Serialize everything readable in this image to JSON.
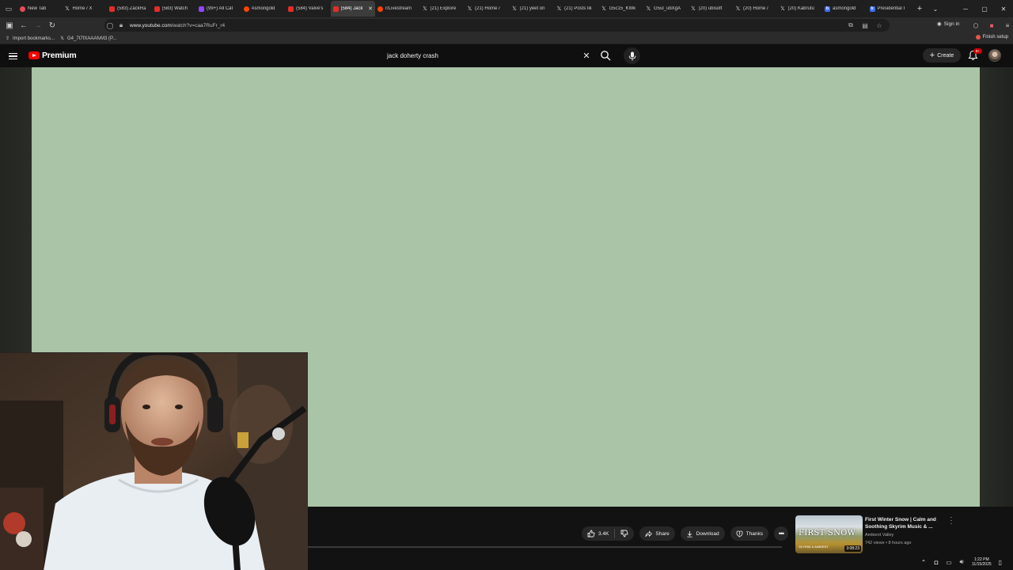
{
  "browser": {
    "tabs": [
      {
        "label": "New Tab",
        "icon": "browser-icon",
        "fav": "am"
      },
      {
        "label": "Home / X",
        "icon": "x-icon",
        "fav": "x"
      },
      {
        "label": "(583) ZackRa",
        "icon": "youtube-icon",
        "fav": "yt"
      },
      {
        "label": "(583) Watch",
        "icon": "youtube-icon",
        "fav": "yt"
      },
      {
        "label": "(99+) All Cat",
        "icon": "twitch-icon",
        "fav": "tw"
      },
      {
        "label": "Asmongold",
        "icon": "reddit-icon",
        "fav": "rd"
      },
      {
        "label": "(584) Valve's",
        "icon": "youtube-icon",
        "fav": "yt"
      },
      {
        "label": "(584) Jack",
        "icon": "youtube-icon",
        "fav": "yt",
        "active": true
      },
      {
        "label": "r/Livestream",
        "icon": "reddit-icon",
        "fav": "rd"
      },
      {
        "label": "(21) Explore",
        "icon": "x-icon",
        "fav": "x"
      },
      {
        "label": "(21) Home /",
        "icon": "x-icon",
        "fav": "x"
      },
      {
        "label": "(21) yeet on",
        "icon": "x-icon",
        "fav": "x"
      },
      {
        "label": "(21) Posts lik",
        "icon": "x-icon",
        "fav": "x"
      },
      {
        "label": "G5c15_KWk",
        "icon": "x-icon",
        "fav": "x"
      },
      {
        "label": "G5ul_ubXgA",
        "icon": "x-icon",
        "fav": "x"
      },
      {
        "label": "(20) ubisoft",
        "icon": "x-icon",
        "fav": "x"
      },
      {
        "label": "(20) Home /",
        "icon": "x-icon",
        "fav": "x"
      },
      {
        "label": "(20) Kabrutu",
        "icon": "x-icon",
        "fav": "x"
      },
      {
        "label": "asmongold",
        "icon": "bing-icon",
        "fav": "bl"
      },
      {
        "label": "Presidential I",
        "icon": "bing-icon",
        "fav": "bl"
      }
    ],
    "url_domain": "www.youtube.com",
    "url_path": "/watch?v=caa7RuFr_r4",
    "signin_label": "Sign in",
    "bookmarks": [
      {
        "label": "Import bookmarks..."
      },
      {
        "label": "G4_7t7fXAAAfvM3 (P..."
      }
    ],
    "finish_setup_label": "Finish setup"
  },
  "youtube": {
    "logo_text": "Premium",
    "search_query": "jack doherty crash",
    "create_label": "Create",
    "notification_badge": "9+",
    "actions": {
      "like_count": "3.4K",
      "share_label": "Share",
      "download_label": "Download",
      "thanks_label": "Thanks"
    },
    "recommended": {
      "thumb_title": "FIRST SNOW",
      "thumb_sub": "SKYRIM & AMBIENT",
      "duration": "3:08:23",
      "title": "First Winter Snow | Calm and Soothing Skyrim Music & ...",
      "channel": "Ambient Valley",
      "meta": "742 views • 8 hours ago"
    }
  },
  "taskbar": {
    "time": "1:22 PM",
    "date": "11/15/2025"
  },
  "colors": {
    "player_bg": "#a9c4a6",
    "youtube_red": "#ff0000",
    "page_bg": "#0f0f0f"
  }
}
